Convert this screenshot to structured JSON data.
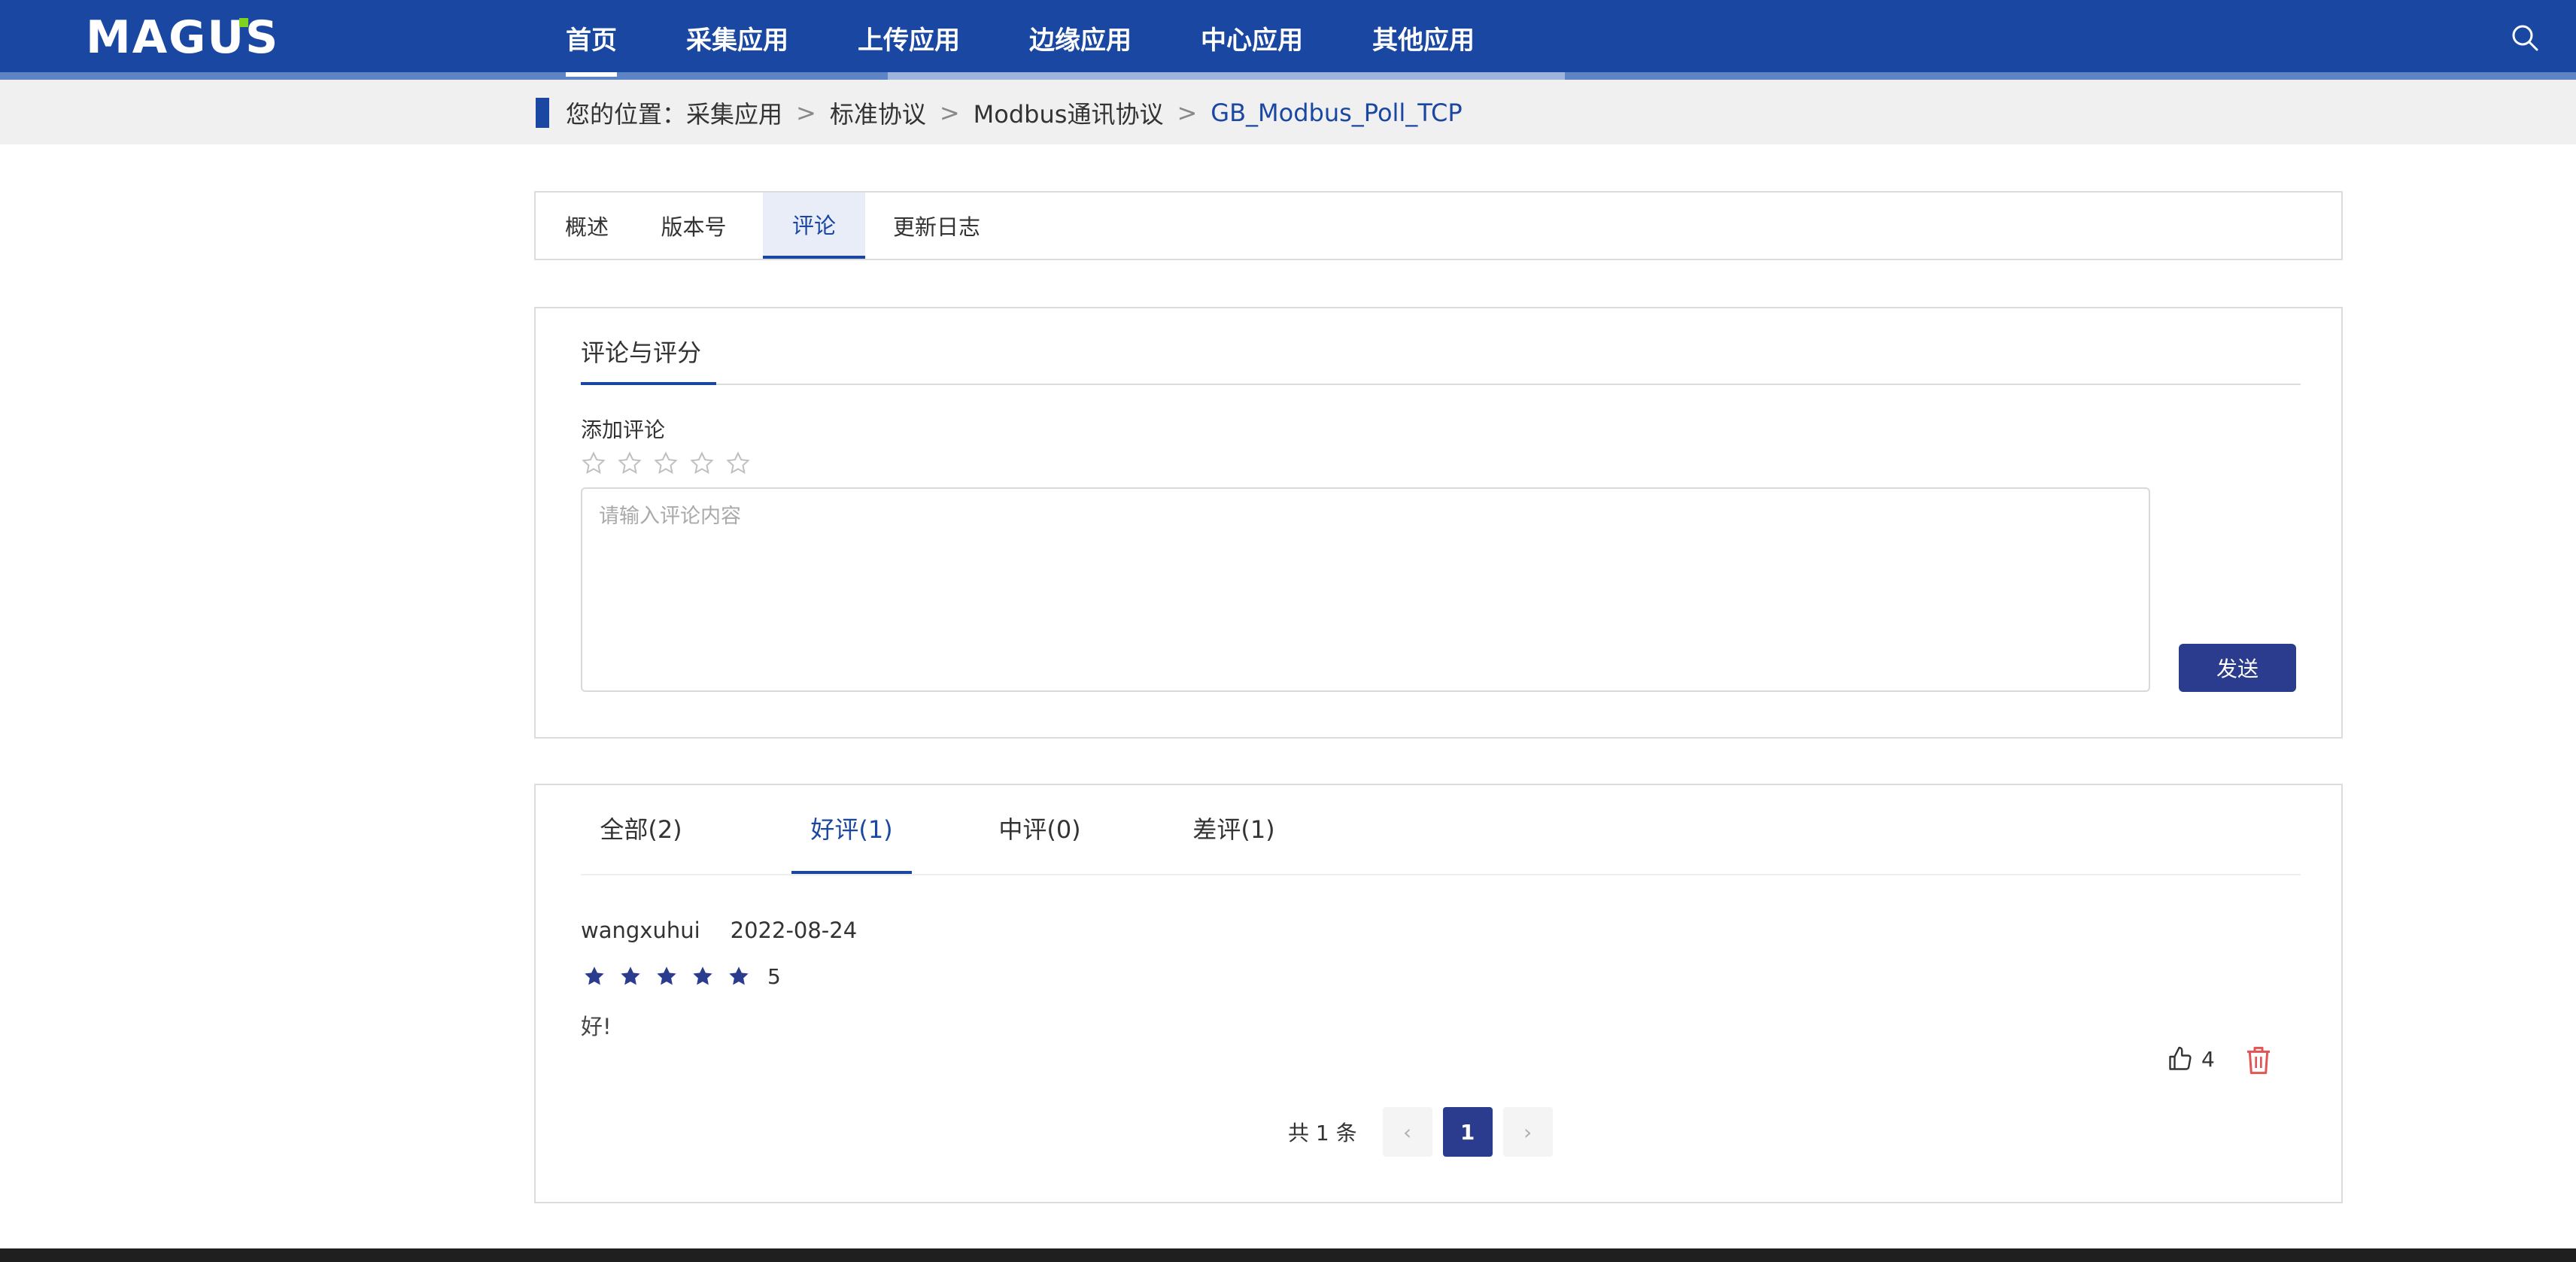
{
  "brand": {
    "logo_text": "MAGUS",
    "accent_color": "#1a47a2",
    "green_dot": "#7ed321"
  },
  "nav": {
    "items": [
      {
        "label": "首页",
        "active": true
      },
      {
        "label": "采集应用",
        "active": false
      },
      {
        "label": "上传应用",
        "active": false
      },
      {
        "label": "边缘应用",
        "active": false
      },
      {
        "label": "中心应用",
        "active": false
      },
      {
        "label": "其他应用",
        "active": false
      }
    ],
    "search_icon": "search-icon"
  },
  "breadcrumb": {
    "prefix": "您的位置：",
    "items": [
      "采集应用",
      "标准协议",
      "Modbus通讯协议"
    ],
    "current": "GB_Modbus_Poll_TCP",
    "separator": ">"
  },
  "tabs": [
    {
      "label": "概述",
      "active": false
    },
    {
      "label": "版本号",
      "active": false
    },
    {
      "label": "评论",
      "active": true
    },
    {
      "label": "更新日志",
      "active": false
    }
  ],
  "comment_form": {
    "heading": "评论与评分",
    "add_label": "添加评论",
    "rating_selected": 0,
    "rating_max": 5,
    "textarea_placeholder": "请输入评论内容",
    "textarea_value": "",
    "send_label": "发送"
  },
  "reviews": {
    "filters": [
      {
        "label": "全部(2)",
        "active": false
      },
      {
        "label": "好评(1)",
        "active": true
      },
      {
        "label": "中评(0)",
        "active": false
      },
      {
        "label": "差评(1)",
        "active": false
      }
    ],
    "items": [
      {
        "user": "wangxuhui",
        "date": "2022-08-24",
        "stars": 5,
        "score": "5",
        "content": "好!",
        "likes": "4"
      }
    ],
    "pagination": {
      "total_text": "共 1 条",
      "prev": "‹",
      "pages": [
        "1"
      ],
      "current": "1",
      "next": "›"
    }
  }
}
